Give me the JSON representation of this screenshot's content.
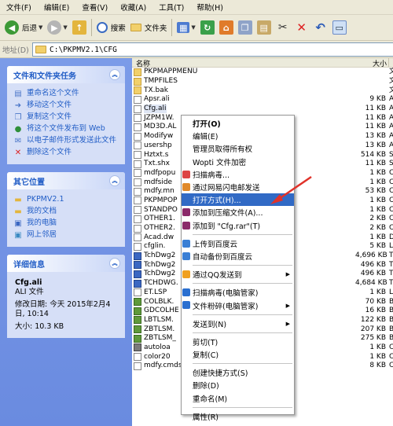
{
  "menubar": [
    "文件(F)",
    "编辑(E)",
    "查看(V)",
    "收藏(A)",
    "工具(T)",
    "帮助(H)"
  ],
  "toolbar": {
    "back": "后退",
    "search": "搜索",
    "folders": "文件夹"
  },
  "address": {
    "label": "地址(D)",
    "path": "C:\\PKPMV2.1\\CFG"
  },
  "tasks": {
    "file_tasks": {
      "title": "文件和文件夹任务",
      "items": [
        "重命名这个文件",
        "移动这个文件",
        "复制这个文件",
        "将这个文件发布到 Web",
        "以电子邮件形式发送此文件",
        "删除这个文件"
      ]
    },
    "other_places": {
      "title": "其它位置",
      "items": [
        "PKPMV2.1",
        "我的文档",
        "我的电脑",
        "网上邻居"
      ]
    },
    "details": {
      "title": "详细信息",
      "filename": "Cfg.ali",
      "filetype": "ALI 文件",
      "modified": "修改日期: 今天 2015年2月4日, 10:14",
      "size": "大小: 10.3 KB"
    }
  },
  "columns": {
    "name": "名称",
    "size": "大小"
  },
  "files": [
    {
      "name": "PKPMAPPMENU",
      "size": "",
      "type": "文",
      "icon": "folder"
    },
    {
      "name": "TMPFILES",
      "size": "",
      "type": "文",
      "icon": "folder"
    },
    {
      "name": "TX.bak",
      "size": "",
      "type": "文",
      "icon": "folder"
    },
    {
      "name": "Apsr.ali",
      "size": "9 KB",
      "type": "A",
      "icon": "file"
    },
    {
      "name": "Cfg.ali",
      "size": "11 KB",
      "type": "A",
      "icon": "file"
    },
    {
      "name": "JZPM1W.",
      "size": "11 KB",
      "type": "A",
      "icon": "file"
    },
    {
      "name": "MD3D.AL",
      "size": "11 KB",
      "type": "A",
      "icon": "file"
    },
    {
      "name": "Modifyw",
      "size": "13 KB",
      "type": "A",
      "icon": "file"
    },
    {
      "name": "usershp",
      "size": "13 KB",
      "type": "A",
      "icon": "file"
    },
    {
      "name": "Hztxt.s",
      "size": "514 KB",
      "type": "S",
      "icon": "file"
    },
    {
      "name": "Txt.shx",
      "size": "11 KB",
      "type": "S",
      "icon": "file"
    },
    {
      "name": "mdfpopu",
      "size": "1 KB",
      "type": "C",
      "icon": "file"
    },
    {
      "name": "mdfside",
      "size": "1 KB",
      "type": "C",
      "icon": "file"
    },
    {
      "name": "mdfy.mn",
      "size": "53 KB",
      "type": "C",
      "icon": "file"
    },
    {
      "name": "PKPMPOP",
      "size": "1 KB",
      "type": "C",
      "icon": "file"
    },
    {
      "name": "STANDPO",
      "size": "1 KB",
      "type": "C",
      "icon": "file"
    },
    {
      "name": "OTHER1.",
      "size": "2 KB",
      "type": "C",
      "icon": "file"
    },
    {
      "name": "OTHER2.",
      "size": "2 KB",
      "type": "C",
      "icon": "file"
    },
    {
      "name": "Acad.dw",
      "size": "1 KB",
      "type": "D",
      "icon": "file"
    },
    {
      "name": "cfglin.",
      "size": "5 KB",
      "type": "L",
      "icon": "file"
    },
    {
      "name": "TchDwg2",
      "size": "4,696 KB",
      "type": "T",
      "icon": "exe"
    },
    {
      "name": "TchDwg2",
      "size": "496 KB",
      "type": "T",
      "icon": "exe"
    },
    {
      "name": "TchDwg2",
      "size": "496 KB",
      "type": "T",
      "icon": "exe"
    },
    {
      "name": "TCHDWG.",
      "size": "4,684 KB",
      "type": "T",
      "icon": "exe"
    },
    {
      "name": "ET.LSP",
      "size": "1 KB",
      "type": "L",
      "icon": "file"
    },
    {
      "name": "COLBLK.",
      "size": "70 KB",
      "type": "B",
      "icon": "img"
    },
    {
      "name": "GDCOLHE",
      "size": "16 KB",
      "type": "B",
      "icon": "img"
    },
    {
      "name": "LBTLSM.",
      "size": "122 KB",
      "type": "B",
      "icon": "img"
    },
    {
      "name": "ZBTLSM.",
      "size": "207 KB",
      "type": "B",
      "icon": "img"
    },
    {
      "name": "ZBTLSM_",
      "size": "275 KB",
      "type": "B",
      "icon": "img"
    },
    {
      "name": "autoloa",
      "size": "1 KB",
      "type": "C",
      "icon": "bat"
    },
    {
      "name": "color20",
      "size": "1 KB",
      "type": "C",
      "icon": "file"
    },
    {
      "name": "mdfy.cmds",
      "size": "8 KB",
      "type": "C",
      "icon": "file"
    }
  ],
  "context_menu": [
    {
      "label": "打开(O)",
      "bold": true,
      "icon": ""
    },
    {
      "label": "编辑(E)",
      "icon": ""
    },
    {
      "label": "管理员取得所有权",
      "icon": ""
    },
    {
      "label": "Wopti 文件加密",
      "icon": ""
    },
    {
      "label": "扫描病毒...",
      "icon": "scan"
    },
    {
      "label": "通过网易闪电邮发送",
      "icon": "mail"
    },
    {
      "label": "打开方式(H)...",
      "highlight": true,
      "icon": ""
    },
    {
      "label": "添加到压缩文件(A)...",
      "icon": "rar"
    },
    {
      "label": "添加到 \"Cfg.rar\"(T)",
      "icon": "rar"
    },
    {
      "sep": true
    },
    {
      "label": "上传到百度云",
      "icon": "cloud"
    },
    {
      "label": "自动备份到百度云",
      "icon": "cloud"
    },
    {
      "sep": true
    },
    {
      "label": "通过QQ发送到",
      "icon": "qq",
      "submenu": true
    },
    {
      "sep": true
    },
    {
      "label": "扫描病毒(电脑管家)",
      "icon": "guard"
    },
    {
      "label": "文件粉碎(电脑管家)",
      "icon": "guard",
      "submenu": true
    },
    {
      "sep": true
    },
    {
      "label": "发送到(N)",
      "icon": "",
      "submenu": true
    },
    {
      "sep": true
    },
    {
      "label": "剪切(T)",
      "icon": ""
    },
    {
      "label": "复制(C)",
      "icon": ""
    },
    {
      "sep": true
    },
    {
      "label": "创建快捷方式(S)",
      "icon": ""
    },
    {
      "label": "删除(D)",
      "icon": ""
    },
    {
      "label": "重命名(M)",
      "icon": ""
    },
    {
      "sep": true
    },
    {
      "label": "属性(R)",
      "icon": ""
    }
  ],
  "colors": {
    "accent": "#316ac5",
    "taskpane": "#6a8be0",
    "arrow": "#e0322a"
  }
}
